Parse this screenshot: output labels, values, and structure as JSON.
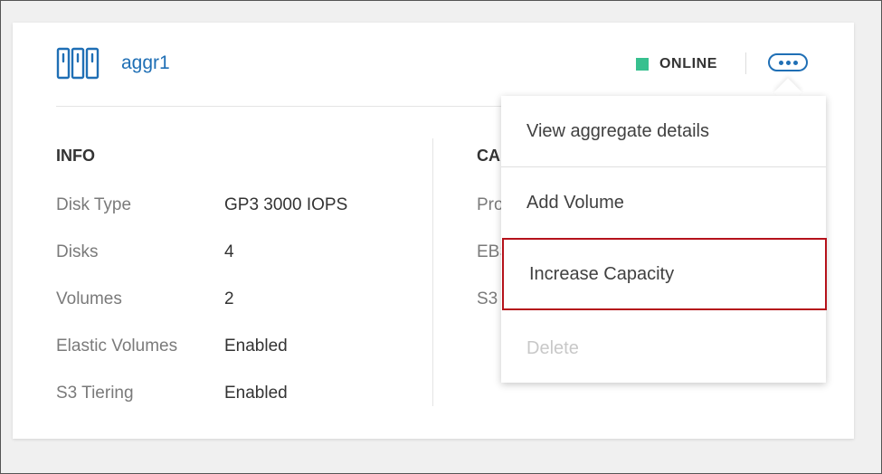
{
  "aggregate": {
    "name": "aggr1",
    "icon": "aggregate-disks-icon",
    "status": "ONLINE",
    "status_color": "#37c08f",
    "accent_color": "#1f6fb5"
  },
  "info": {
    "title": "INFO",
    "rows": [
      {
        "label": "Disk Type",
        "value": "GP3 3000 IOPS"
      },
      {
        "label": "Disks",
        "value": "4"
      },
      {
        "label": "Volumes",
        "value": "2"
      },
      {
        "label": "Elastic Volumes",
        "value": "Enabled"
      },
      {
        "label": "S3 Tiering",
        "value": "Enabled"
      }
    ]
  },
  "capacity": {
    "title_partial": "CA",
    "rows_partial": [
      "Pro",
      "EBS",
      "S3"
    ]
  },
  "menu": {
    "items": [
      {
        "label": "View aggregate details",
        "enabled": true
      },
      {
        "label": "Add Volume",
        "enabled": true
      },
      {
        "label": "Increase Capacity",
        "enabled": true,
        "highlighted": true
      },
      {
        "label": "Delete",
        "enabled": false
      }
    ],
    "highlight_color": "#b5121b"
  }
}
